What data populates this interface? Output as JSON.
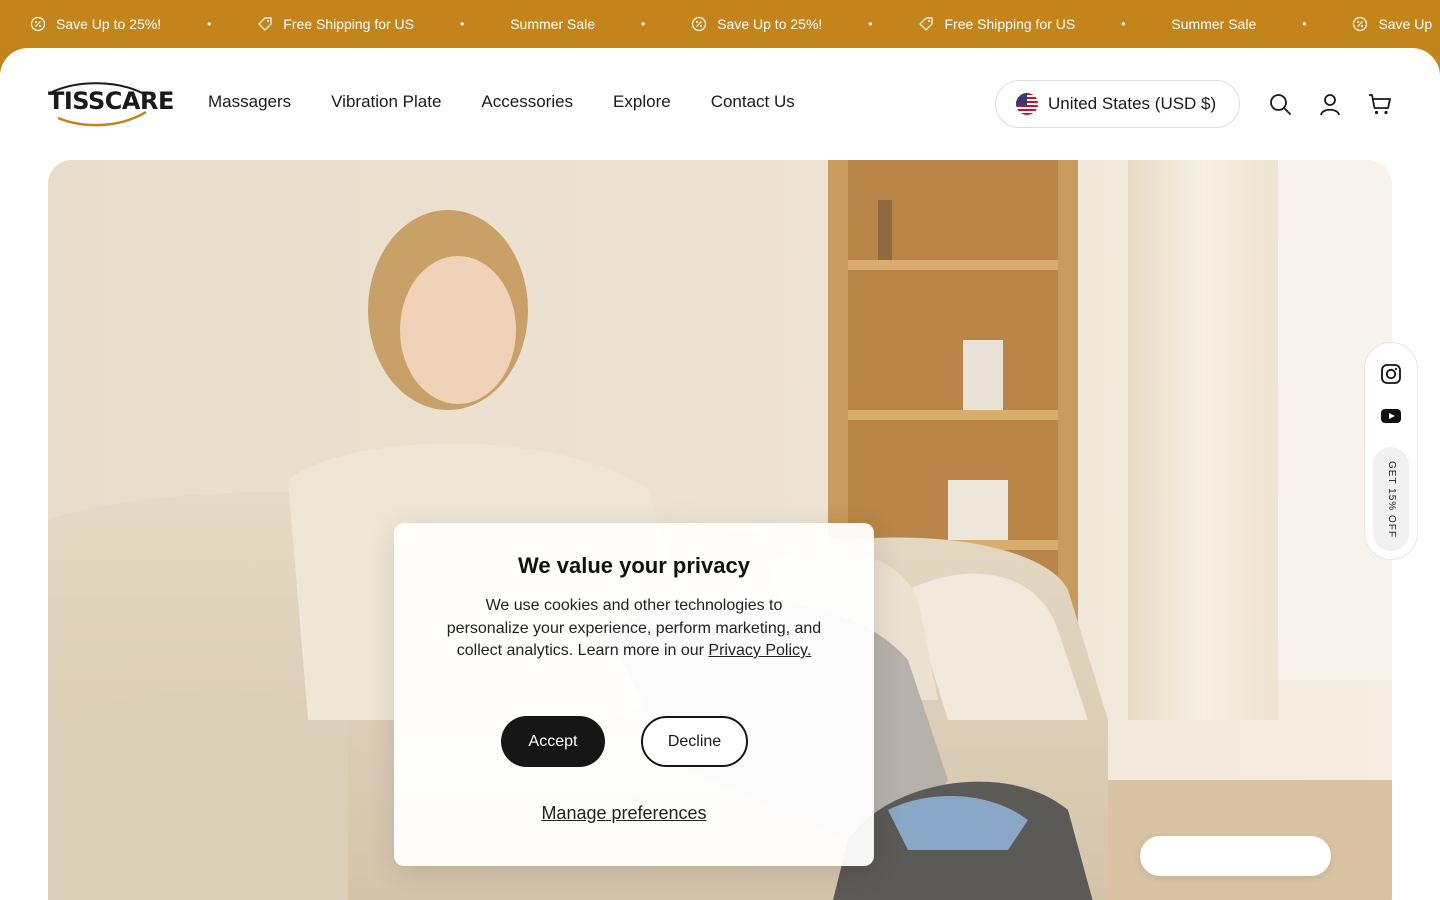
{
  "announcement": {
    "items": [
      {
        "icon": "discount-badge-icon",
        "text": "Save Up to 25%!"
      },
      {
        "icon": "shipping-tag-icon",
        "text": "Free Shipping for US"
      },
      {
        "icon": "",
        "text": "Summer Sale"
      },
      {
        "icon": "discount-badge-icon",
        "text": "Save Up to 25%!"
      },
      {
        "icon": "shipping-tag-icon",
        "text": "Free Shipping for US"
      },
      {
        "icon": "",
        "text": "Summer Sale"
      },
      {
        "icon": "discount-badge-icon",
        "text": "Save Up"
      }
    ],
    "separator": "•",
    "bg_color": "#c2841b"
  },
  "header": {
    "logo_text": "TISSCARE",
    "nav": [
      "Massagers",
      "Vibration Plate",
      "Accessories",
      "Explore",
      "Contact Us"
    ],
    "country_selector": "United States (USD $)",
    "icons": [
      "search-icon",
      "account-icon",
      "cart-icon"
    ]
  },
  "side_rail": {
    "icons": [
      "instagram-icon",
      "youtube-icon"
    ],
    "promo_label": "GET 15% OFF"
  },
  "cookie_banner": {
    "title": "We value your privacy",
    "body": "We use cookies and other technologies to personalize your experience, perform marketing, and collect analytics. Learn more in our",
    "link_text": "Privacy Policy.",
    "accept_label": "Accept",
    "decline_label": "Decline",
    "manage_label": "Manage preferences"
  }
}
